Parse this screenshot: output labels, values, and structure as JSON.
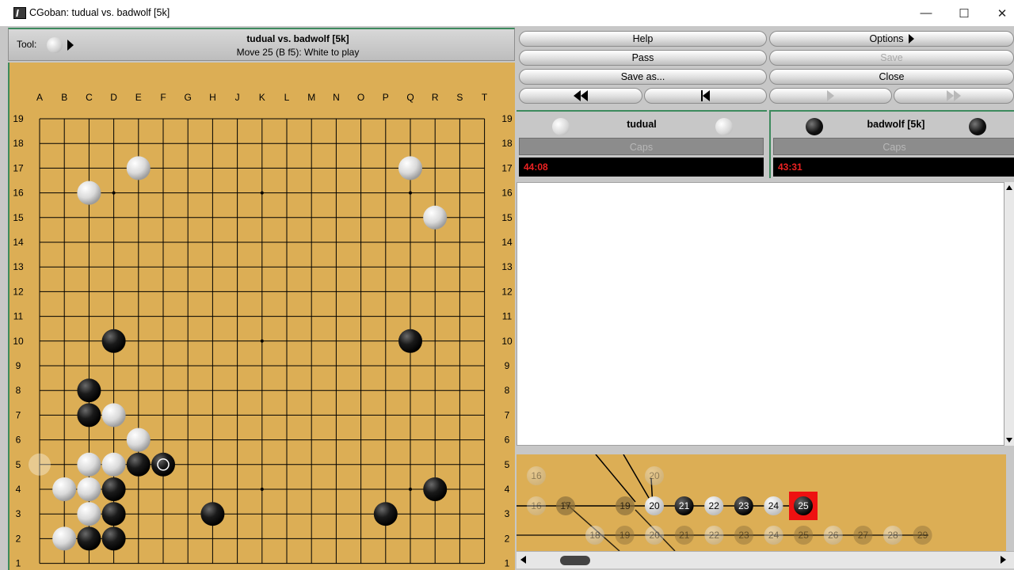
{
  "window": {
    "title": "CGoban: tudual vs. badwolf [5k]",
    "minimize": "—",
    "maximize": "☐",
    "close": "✕"
  },
  "header": {
    "tool_label": "Tool:",
    "game_title": "tudual vs. badwolf [5k]",
    "move_info": "Move 25 (B f5): White to play"
  },
  "board": {
    "columns": [
      "A",
      "B",
      "C",
      "D",
      "E",
      "F",
      "G",
      "H",
      "J",
      "K",
      "L",
      "M",
      "N",
      "O",
      "P",
      "Q",
      "R",
      "S",
      "T"
    ],
    "rows": [
      "19",
      "18",
      "17",
      "16",
      "15",
      "14",
      "13",
      "12",
      "11",
      "10",
      "9",
      "8",
      "7",
      "6",
      "5",
      "4",
      "3",
      "2",
      "1"
    ],
    "white_stones": [
      "E17",
      "C16",
      "Q17",
      "R15",
      "D7",
      "E6",
      "C5",
      "D5",
      "B4",
      "C4",
      "C3",
      "B2"
    ],
    "black_stones": [
      "D10",
      "Q10",
      "C8",
      "C7",
      "E5",
      "F5",
      "D4",
      "R4",
      "D3",
      "H3",
      "P3",
      "C2",
      "D2"
    ],
    "last_move": "F5",
    "hover": "A5",
    "hoshi": [
      "D16",
      "K16",
      "Q16",
      "D10",
      "K10",
      "Q10",
      "D4",
      "K4",
      "Q4"
    ]
  },
  "controls": {
    "help": "Help",
    "options": "Options",
    "pass": "Pass",
    "save": "Save",
    "save_as": "Save as...",
    "close": "Close"
  },
  "players": {
    "white": {
      "name": "tudual",
      "caps": "Caps",
      "time": "44:08"
    },
    "black": {
      "name": "badwolf [5k]",
      "caps": "Caps",
      "time": "43:31"
    }
  },
  "tree": {
    "current": "25",
    "main": [
      "20",
      "21",
      "22",
      "23",
      "24",
      "25"
    ],
    "main_colors": [
      "w",
      "b",
      "w",
      "b",
      "w",
      "b"
    ],
    "faded_top": [
      "16",
      "20"
    ],
    "faded_mid": [
      "16",
      "17",
      "19"
    ],
    "bottom": [
      "18",
      "19",
      "20",
      "21",
      "22",
      "23",
      "24",
      "25",
      "26",
      "27",
      "28",
      "29"
    ]
  },
  "colors": {
    "board": "#dcae55",
    "frame_green": "#3d8a5d",
    "clock_text": "#ee2222",
    "current_move": "#ee1111"
  }
}
